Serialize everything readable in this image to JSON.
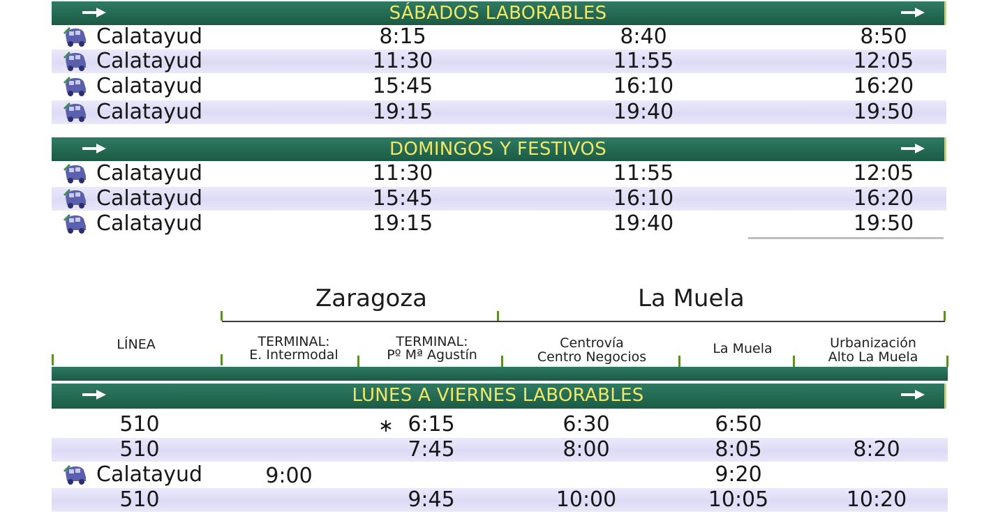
{
  "sabados": {
    "title": "SÁBADOS LABORABLES",
    "rows": [
      {
        "origin": "Calatayud",
        "t1": "8:15",
        "t2": "8:40",
        "t3": "8:50"
      },
      {
        "origin": "Calatayud",
        "t1": "11:30",
        "t2": "11:55",
        "t3": "12:05"
      },
      {
        "origin": "Calatayud",
        "t1": "15:45",
        "t2": "16:10",
        "t3": "16:20"
      },
      {
        "origin": "Calatayud",
        "t1": "19:15",
        "t2": "19:40",
        "t3": "19:50"
      }
    ]
  },
  "domingos": {
    "title": "DOMINGOS Y FESTIVOS",
    "rows": [
      {
        "origin": "Calatayud",
        "t1": "11:30",
        "t2": "11:55",
        "t3": "12:05"
      },
      {
        "origin": "Calatayud",
        "t1": "15:45",
        "t2": "16:10",
        "t3": "16:20"
      },
      {
        "origin": "Calatayud",
        "t1": "19:15",
        "t2": "19:40",
        "t3": "19:50"
      }
    ]
  },
  "cities": {
    "left": "Zaragoza",
    "right": "La Muela"
  },
  "columns": {
    "linea": "LÍNEA",
    "c1a": "TERMINAL:",
    "c1b": "E. Intermodal",
    "c2a": "TERMINAL:",
    "c2b": "Pº Mª Agustín",
    "c3a": "Centrovía",
    "c3b": "Centro Negocios",
    "c4": "La Muela",
    "c5a": "Urbanización",
    "c5b": "Alto La Muela"
  },
  "lunes": {
    "title": "LUNES A VIERNES LABORABLES",
    "rows": [
      {
        "linea": "510",
        "c1": "",
        "c2": "6:15",
        "c3": "6:30",
        "c4": "6:50",
        "c5": ""
      },
      {
        "linea": "510",
        "c1": "",
        "c2": "7:45",
        "c3": "8:00",
        "c4": "8:05",
        "c5": "8:20"
      },
      {
        "linea": "Calatayud",
        "c1": "9:00",
        "c2": "",
        "c3": "",
        "c4": "9:20",
        "c5": ""
      },
      {
        "linea": "510",
        "c1": "",
        "c2": "9:45",
        "c3": "10:00",
        "c4": "10:05",
        "c5": "10:20"
      }
    ],
    "star": "∗"
  },
  "colors": {
    "bar": "#1f5f4a",
    "bar_text": "#f1e868",
    "stripe": "#e2e0f7",
    "tick": "#5b8f2a"
  }
}
